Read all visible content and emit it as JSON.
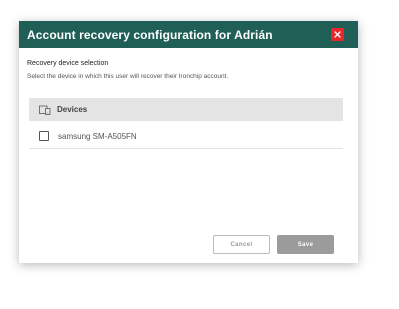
{
  "dialog": {
    "title": "Account recovery configuration for Adrián",
    "close_icon": "close-icon",
    "header_color": "#1f5f56",
    "close_color": "#e8262b"
  },
  "section": {
    "title": "Recovery device selection",
    "description": "Select the device in which this user will recover their Ironchip account."
  },
  "table": {
    "header_icon": "devices-icon",
    "header_label": "Devices",
    "rows": [
      {
        "label": "samsung SM-A505FN",
        "checked": false
      }
    ]
  },
  "buttons": {
    "cancel_label": "Cancel",
    "save_label": "Save"
  }
}
